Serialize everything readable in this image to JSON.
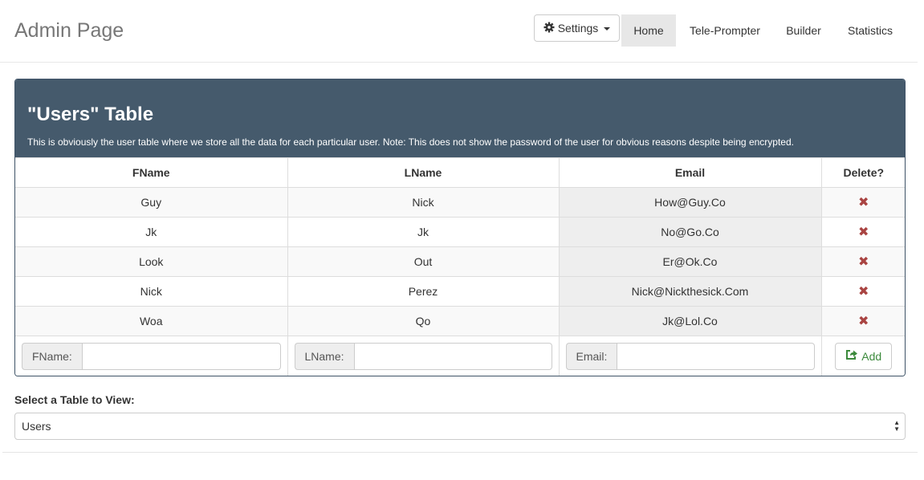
{
  "navbar": {
    "brand": "Admin Page",
    "settings_label": "Settings",
    "items": [
      {
        "label": "Home",
        "active": true
      },
      {
        "label": "Tele-Prompter",
        "active": false
      },
      {
        "label": "Builder",
        "active": false
      },
      {
        "label": "Statistics",
        "active": false
      }
    ]
  },
  "panel": {
    "title": "\"Users\" Table",
    "description": "This is obviously the user table where we store all the data for each particular user. Note: This does not show the password of the user for obvious reasons despite being encrypted."
  },
  "table": {
    "headers": [
      "FName",
      "LName",
      "Email",
      "Delete?"
    ],
    "rows": [
      {
        "fname": "Guy",
        "lname": "Nick",
        "email": "How@Guy.Co"
      },
      {
        "fname": "Jk",
        "lname": "Jk",
        "email": "No@Go.Co"
      },
      {
        "fname": "Look",
        "lname": "Out",
        "email": "Er@Ok.Co"
      },
      {
        "fname": "Nick",
        "lname": "Perez",
        "email": "Nick@Nickthesick.Com"
      },
      {
        "fname": "Woa",
        "lname": "Qo",
        "email": "Jk@Lol.Co"
      }
    ],
    "delete_glyph": "✖",
    "form": {
      "fname_label": "FName:",
      "fname_value": "",
      "lname_label": "LName:",
      "lname_value": "",
      "email_label": "Email:",
      "email_value": "",
      "add_label": "Add"
    }
  },
  "selector": {
    "label": "Select a Table to View:",
    "selected": "Users"
  },
  "colors": {
    "panel_header": "#455a6c",
    "delete_icon": "#a94442",
    "add_button": "#3c8a3c"
  }
}
